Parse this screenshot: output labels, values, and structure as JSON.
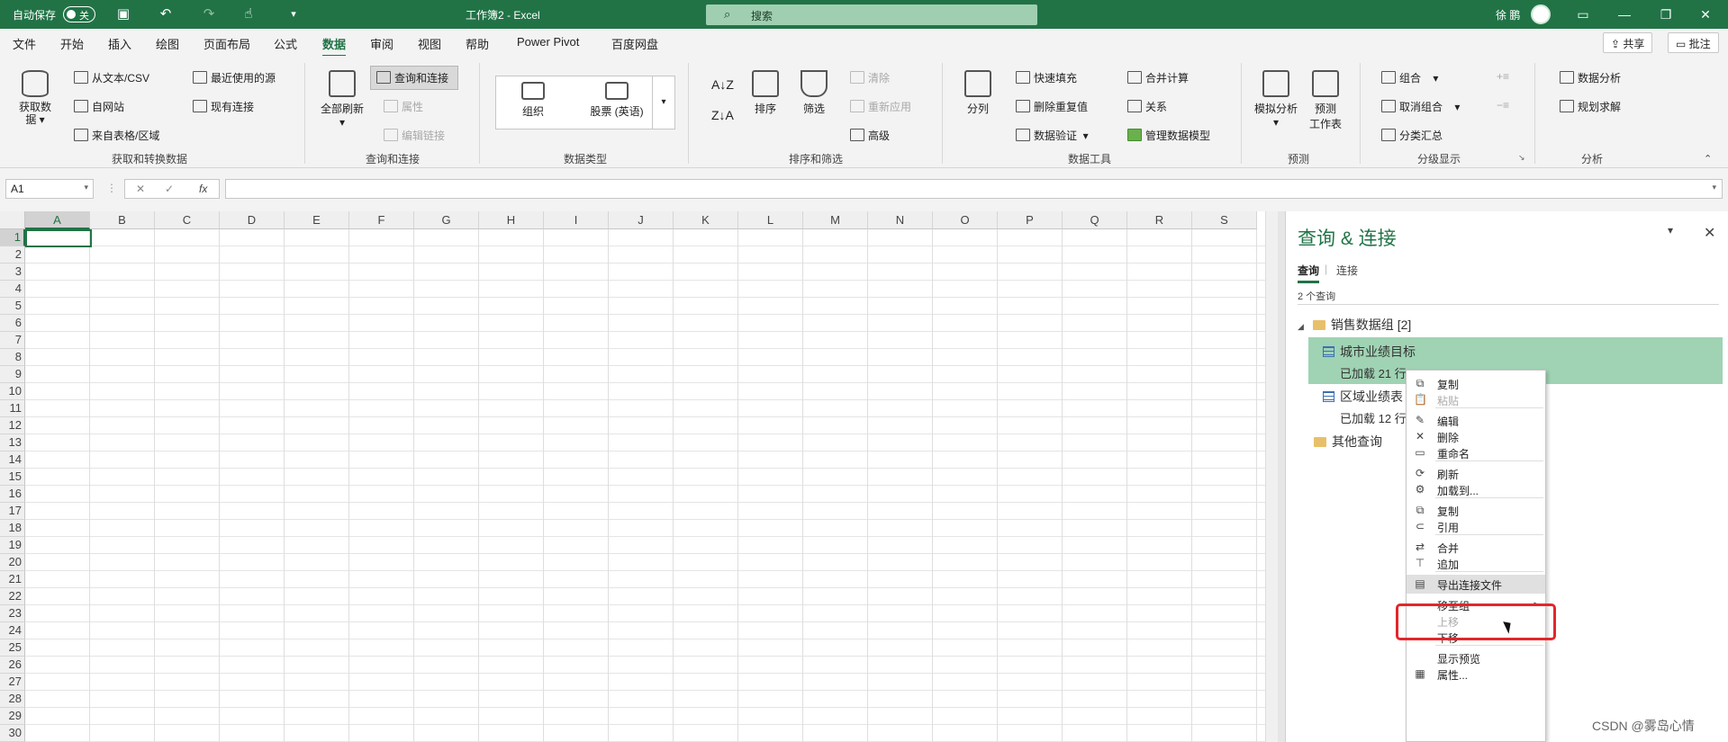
{
  "titlebar": {
    "autosave_label": "自动保存",
    "autosave_state": "关",
    "doc_title": "工作簿2  -  Excel",
    "search_placeholder": "搜索",
    "user_name": "徐 鹏"
  },
  "menu_tabs": [
    "文件",
    "开始",
    "插入",
    "绘图",
    "页面布局",
    "公式",
    "数据",
    "审阅",
    "视图",
    "帮助",
    "Power Pivot",
    "百度网盘"
  ],
  "active_tab": "数据",
  "share_label": "共享",
  "comment_label": "批注",
  "ribbon": {
    "get_data": {
      "big": "获取数\n据",
      "from_text": "从文本/CSV",
      "from_web": "自网站",
      "from_table": "来自表格/区域",
      "recent_sources": "最近使用的源",
      "existing_conn": "现有连接",
      "group_label": "获取和转换数据"
    },
    "queries": {
      "refresh_all": "全部刷新",
      "queries_conn": "查询和连接",
      "properties": "属性",
      "edit_links": "编辑链接",
      "group_label": "查询和连接"
    },
    "datatypes": {
      "org": "组织",
      "stocks": "股票 (英语)",
      "group_label": "数据类型"
    },
    "sort": {
      "sort": "排序",
      "filter": "筛选",
      "clear": "清除",
      "reapply": "重新应用",
      "advanced": "高级",
      "group_label": "排序和筛选"
    },
    "tools": {
      "split": "分列",
      "flash_fill": "快速填充",
      "remove_dup": "删除重复值",
      "validation": "数据验证",
      "consolidate": "合并计算",
      "relations": "关系",
      "manage_model": "管理数据模型",
      "group_label": "数据工具"
    },
    "forecast": {
      "whatif": "模拟分析",
      "sheet_line1": "预测",
      "sheet_line2": "工作表",
      "group_label": "预测"
    },
    "outline": {
      "group": "组合",
      "ungroup": "取消组合",
      "subtotal": "分类汇总",
      "group_label": "分级显示"
    },
    "analysis": {
      "data_analysis": "数据分析",
      "solver": "规划求解",
      "group_label": "分析"
    }
  },
  "formula_bar": {
    "name_box": "A1",
    "formula": ""
  },
  "sheet": {
    "columns": [
      "A",
      "B",
      "C",
      "D",
      "E",
      "F",
      "G",
      "H",
      "I",
      "J",
      "K",
      "L",
      "M",
      "N",
      "O",
      "P",
      "Q",
      "R",
      "S"
    ],
    "rows": [
      1,
      2,
      3,
      4,
      5,
      6,
      7,
      8,
      9,
      10,
      11,
      12,
      13,
      14,
      15,
      16,
      17,
      18,
      19,
      20,
      21,
      22,
      23,
      24,
      25,
      26,
      27,
      28,
      29,
      30
    ],
    "active_cell": "A1"
  },
  "pane": {
    "title": "查询 & 连接",
    "tabs": [
      "查询",
      "连接"
    ],
    "query_count": "2 个查询",
    "group_name": "销售数据组 [2]",
    "queries": [
      {
        "name": "城市业绩目标",
        "status": "已加载 21 行"
      },
      {
        "name": "区域业绩表",
        "status": "已加载 12 行"
      }
    ],
    "other_group": "其他查询"
  },
  "context_menu": [
    {
      "label": "复制",
      "icon": "copy-icon",
      "disabled": false
    },
    {
      "label": "粘贴",
      "icon": "paste-icon",
      "disabled": true
    },
    {
      "label": "编辑",
      "icon": "edit-icon",
      "disabled": false
    },
    {
      "label": "删除",
      "icon": "delete-icon",
      "disabled": false
    },
    {
      "label": "重命名",
      "icon": "rename-icon",
      "disabled": false
    },
    {
      "label": "刷新",
      "icon": "refresh-icon",
      "disabled": false
    },
    {
      "label": "加载到...",
      "icon": "load-to-icon",
      "disabled": false
    },
    {
      "label": "复制",
      "icon": "duplicate-icon",
      "disabled": false
    },
    {
      "label": "引用",
      "icon": "reference-icon",
      "disabled": false
    },
    {
      "label": "合并",
      "icon": "merge-icon",
      "disabled": false
    },
    {
      "label": "追加",
      "icon": "append-icon",
      "disabled": false
    },
    {
      "label": "导出连接文件",
      "icon": "export-connection-icon",
      "disabled": false
    },
    {
      "label": "移至组",
      "icon": "",
      "disabled": false
    },
    {
      "label": "上移",
      "icon": "",
      "disabled": true
    },
    {
      "label": "下移",
      "icon": "",
      "disabled": false
    },
    {
      "label": "显示预览",
      "icon": "",
      "disabled": false
    },
    {
      "label": "属性...",
      "icon": "properties-icon",
      "disabled": false
    }
  ],
  "watermark": "CSDN @雾岛心情",
  "colors": {
    "brand": "#217346",
    "selection": "#9fd3b3",
    "highlight": "#e3262b"
  }
}
